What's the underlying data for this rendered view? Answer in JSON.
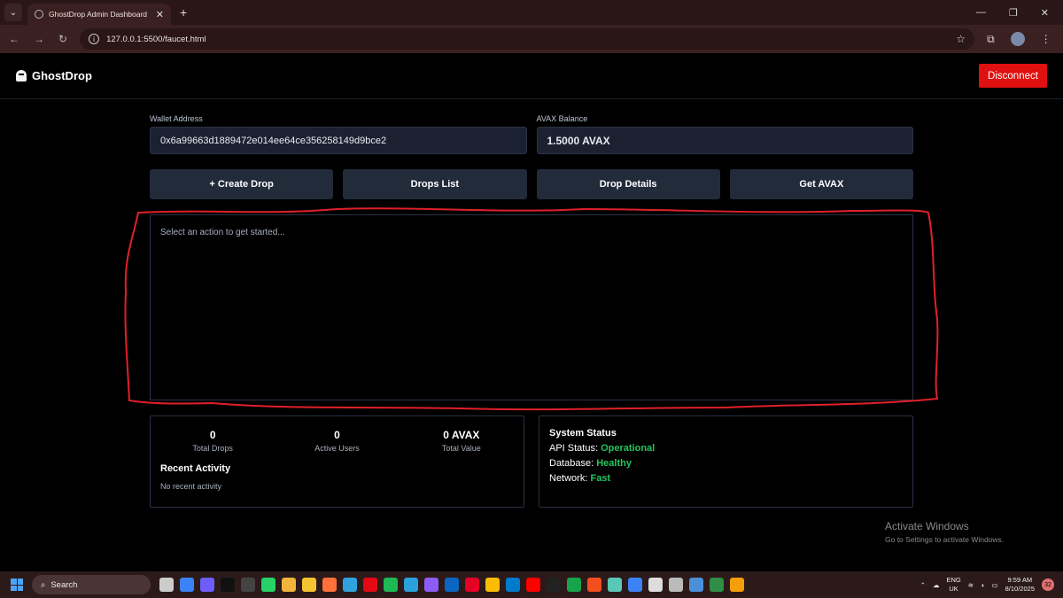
{
  "browser": {
    "tab_title": "GhostDrop Admin Dashboard",
    "url": "127.0.0.1:5500/faucet.html"
  },
  "app": {
    "brand": "GhostDrop",
    "disconnect_label": "Disconnect",
    "wallet": {
      "label": "Wallet Address",
      "value": "0x6a99663d1889472e014ee64ce356258149d9bce2"
    },
    "balance": {
      "label": "AVAX Balance",
      "value": "1.5000 AVAX"
    },
    "actions": [
      {
        "label": "+ Create Drop"
      },
      {
        "label": "Drops List"
      },
      {
        "label": "Drop Details"
      },
      {
        "label": "Get AVAX"
      }
    ],
    "panel_placeholder": "Select an action to get started...",
    "stats": [
      {
        "value": "0",
        "label": "Total Drops"
      },
      {
        "value": "0",
        "label": "Active Users"
      },
      {
        "value": "0 AVAX",
        "label": "Total Value"
      }
    ],
    "recent_activity": {
      "title": "Recent Activity",
      "empty": "No recent activity"
    },
    "system_status": {
      "title": "System Status",
      "rows": [
        {
          "label": "API Status: ",
          "value": "Operational"
        },
        {
          "label": "Database: ",
          "value": "Healthy"
        },
        {
          "label": "Network: ",
          "value": "Fast"
        }
      ],
      "ok_color": "#22c55e"
    },
    "accent_danger": "#e01010"
  },
  "os": {
    "activate_title": "Activate Windows",
    "activate_sub": "Go to Settings to activate Windows.",
    "search_label": "Search",
    "lang": "ENG",
    "region": "UK",
    "time": "9:59 AM",
    "date": "8/10/2025",
    "notifications": "32"
  }
}
